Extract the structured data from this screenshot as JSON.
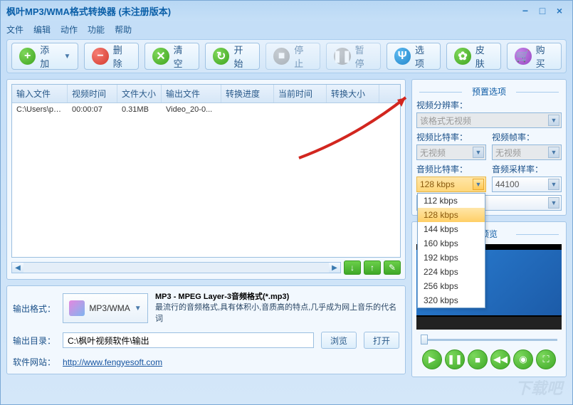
{
  "title": "枫叶MP3/WMA格式转换器    (未注册版本)",
  "menu": {
    "file": "文件",
    "edit": "编辑",
    "action": "动作",
    "function": "功能",
    "help": "帮助"
  },
  "toolbar": {
    "add": "添加",
    "delete": "删除",
    "clear": "清空",
    "start": "开始",
    "stop": "停止",
    "pause": "暂停",
    "options": "选项",
    "skin": "皮肤",
    "buy": "购买"
  },
  "table": {
    "headers": {
      "c1": "输入文件",
      "c2": "视频时间",
      "c3": "文件大小",
      "c4": "输出文件",
      "c5": "转换进度",
      "c6": "当前时间",
      "c7": "转换大小"
    },
    "rows": [
      {
        "c1": "C:\\Users\\pc\\...",
        "c2": "00:00:07",
        "c3": "0.31MB",
        "c4": "Video_20-0...",
        "c5": "",
        "c6": "",
        "c7": ""
      }
    ]
  },
  "output": {
    "fmt_label": "输出格式：",
    "fmt_name": "MP3/WMA",
    "desc_title": "MP3 - MPEG Layer-3音频格式(*.mp3)",
    "desc_body": "最流行的音频格式,具有体积小,音质高的特点,几乎成为网上音乐的代名词",
    "dir_label": "输出目录：",
    "dir_value": "C:\\枫叶视频软件\\输出",
    "browse": "浏览",
    "open": "打开",
    "site_label": "软件网站：",
    "site_url": "http://www.fengyesoft.com"
  },
  "preset": {
    "title": "预置选项",
    "video_res_label": "视频分辨率：",
    "video_res_value": "该格式无视频",
    "video_bitrate_label": "视频比特率：",
    "video_bitrate_value": "无视频",
    "video_fps_label": "视频帧率：",
    "video_fps_value": "无视频",
    "audio_bitrate_label": "音频比特率：",
    "audio_bitrate_value": "128 kbps",
    "audio_sample_label": "音频采样率：",
    "audio_sample_value": "44100",
    "bitrate_options": [
      "112 kbps",
      "128 kbps",
      "144 kbps",
      "160 kbps",
      "192 kbps",
      "224 kbps",
      "256 kbps",
      "320 kbps"
    ]
  },
  "preview": {
    "title": "预览"
  },
  "watermark": "下载吧"
}
